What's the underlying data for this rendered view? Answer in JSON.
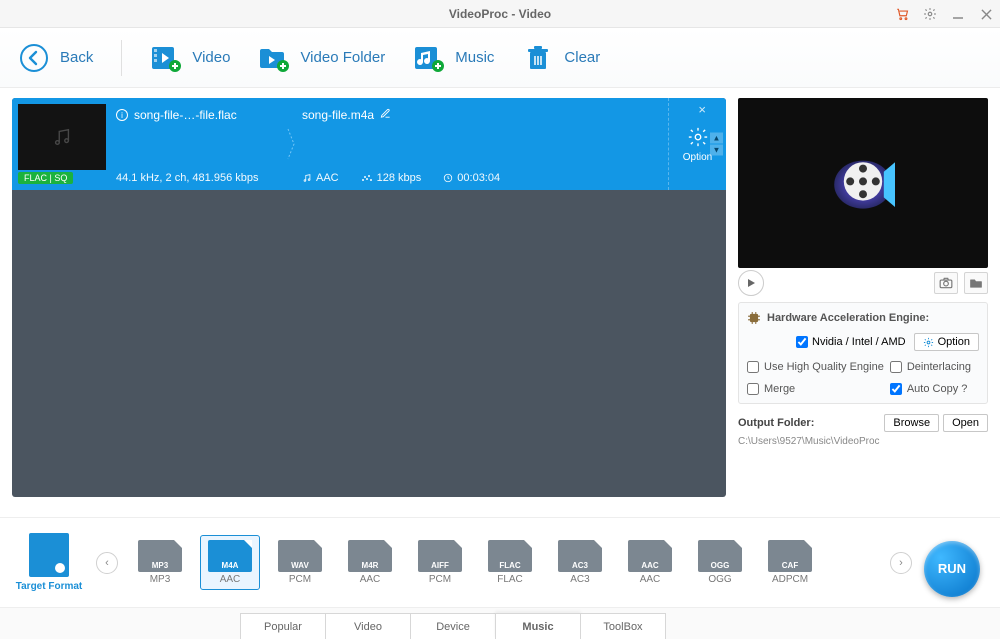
{
  "title": "VideoProc - Video",
  "toolbar": {
    "back": "Back",
    "video": "Video",
    "video_folder": "Video Folder",
    "music": "Music",
    "clear": "Clear"
  },
  "queue": {
    "item": {
      "source_name": "song-file-…-file.flac",
      "source_info": "44.1 kHz, 2 ch, 481.956 kbps",
      "badge": "FLAC | SQ",
      "target_name": "song-file.m4a",
      "target_codec": "AAC",
      "target_bitrate": "128 kbps",
      "target_duration": "00:03:04",
      "option_label": "Option"
    }
  },
  "rightPanel": {
    "hw_title": "Hardware Acceleration Engine:",
    "hw_vendor": "Nvidia / Intel / AMD",
    "hw_option": "Option",
    "hq_engine": "Use High Quality Engine",
    "deinterlacing": "Deinterlacing",
    "merge": "Merge",
    "auto_copy": "Auto Copy ?",
    "output_label": "Output Folder:",
    "browse": "Browse",
    "open": "Open",
    "output_path": "C:\\Users\\9527\\Music\\VideoProc"
  },
  "targetFormat": {
    "label": "Target Format",
    "items": [
      {
        "container": "MP3",
        "codec": "MP3"
      },
      {
        "container": "M4A",
        "codec": "AAC"
      },
      {
        "container": "WAV",
        "codec": "PCM"
      },
      {
        "container": "M4R",
        "codec": "AAC"
      },
      {
        "container": "AIFF",
        "codec": "PCM"
      },
      {
        "container": "FLAC",
        "codec": "FLAC"
      },
      {
        "container": "AC3",
        "codec": "AC3"
      },
      {
        "container": "AAC",
        "codec": "AAC"
      },
      {
        "container": "OGG",
        "codec": "OGG"
      },
      {
        "container": "CAF",
        "codec": "ADPCM"
      }
    ],
    "active_index": 1
  },
  "bottomTabs": [
    "Popular",
    "Video",
    "Device",
    "Music",
    "ToolBox"
  ],
  "bottomTabs_active": 3,
  "run_label": "RUN"
}
